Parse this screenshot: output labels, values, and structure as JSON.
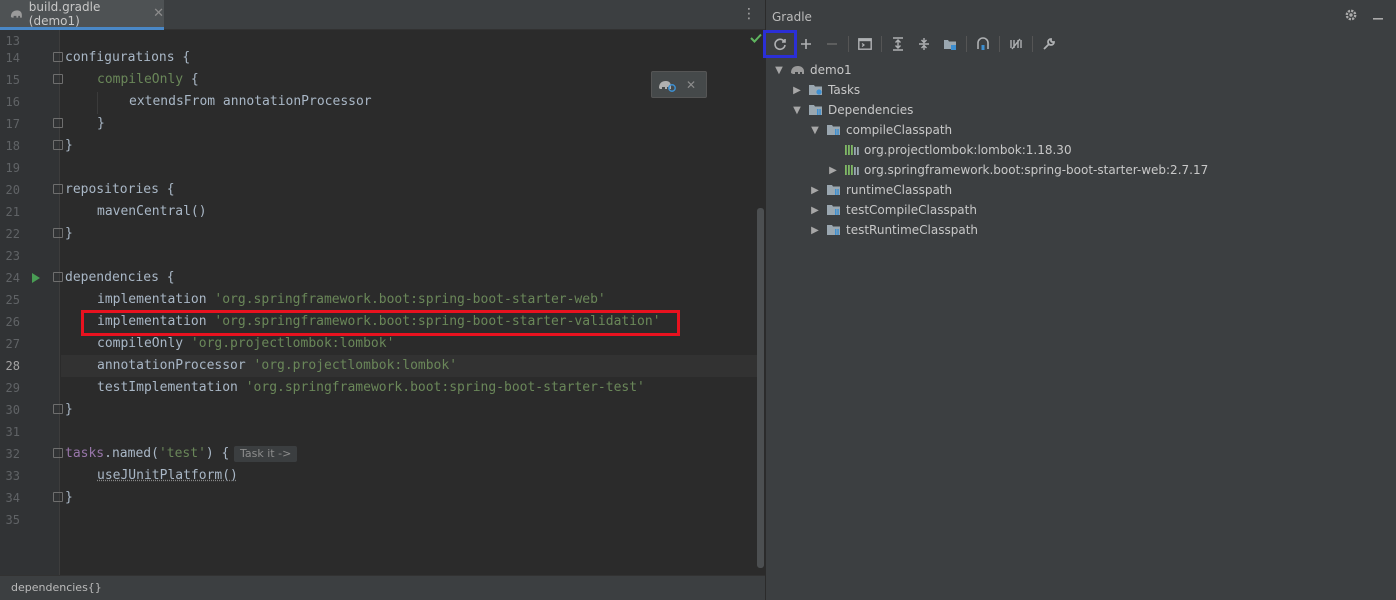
{
  "editor": {
    "tab_label": "build.gradle (demo1)",
    "tab_close": "✕",
    "tab_menu": "⋮",
    "line_numbers": [
      "13",
      "14",
      "15",
      "16",
      "17",
      "18",
      "19",
      "20",
      "21",
      "22",
      "23",
      "24",
      "25",
      "26",
      "27",
      "28",
      "29",
      "30",
      "31",
      "32",
      "33",
      "34",
      "35"
    ],
    "active_line": "28",
    "lines": {
      "l14_kw": "configurations",
      "l14_brace": " {",
      "l15_a": "compileOnly",
      "l15_b": " {",
      "l16": "extendsFrom annotationProcessor",
      "l17": "}",
      "l18": "}",
      "l20_kw": "repositories",
      "l20_b": " {",
      "l21": "mavenCentral()",
      "l22": "}",
      "l24_kw": "dependencies",
      "l24_b": " {",
      "l25_a": "implementation ",
      "l25_b": "'org.springframework.boot:spring-boot-starter-web'",
      "l26_a": "implementation ",
      "l26_b": "'org.springframework.boot:spring-boot-starter-validation'",
      "l27_a": "compileOnly ",
      "l27_b": "'org.projectlombok:lombok'",
      "l28_a": "annotationProcessor ",
      "l28_b": "'org.projectlombok:lombok'",
      "l29_a": "testImplementation ",
      "l29_b": "'org.springframework.boot:spring-boot-starter-test'",
      "l30": "}",
      "l32_a": "tasks",
      "l32_b": ".named(",
      "l32_c": "'test'",
      "l32_d": ") {",
      "l33": "useJUnitPlatform()",
      "l34": "}"
    },
    "inlay_hint": "Task it ->",
    "popup_close": "✕",
    "breadcrumb": "dependencies{}"
  },
  "gradle": {
    "title": "Gradle",
    "tree": {
      "root": "demo1",
      "tasks": "Tasks",
      "dependencies": "Dependencies",
      "compile_classpath": "compileClasspath",
      "lombok": "org.projectlombok:lombok:1.18.30",
      "spring_web": "org.springframework.boot:spring-boot-starter-web:2.7.17",
      "runtime_classpath": "runtimeClasspath",
      "test_compile_classpath": "testCompileClasspath",
      "test_runtime_classpath": "testRuntimeClasspath"
    }
  },
  "colors": {
    "highlight_red": "#e8121f",
    "highlight_blue": "#2b2fd6",
    "keyword": "#cc7832",
    "string": "#6a8759"
  }
}
